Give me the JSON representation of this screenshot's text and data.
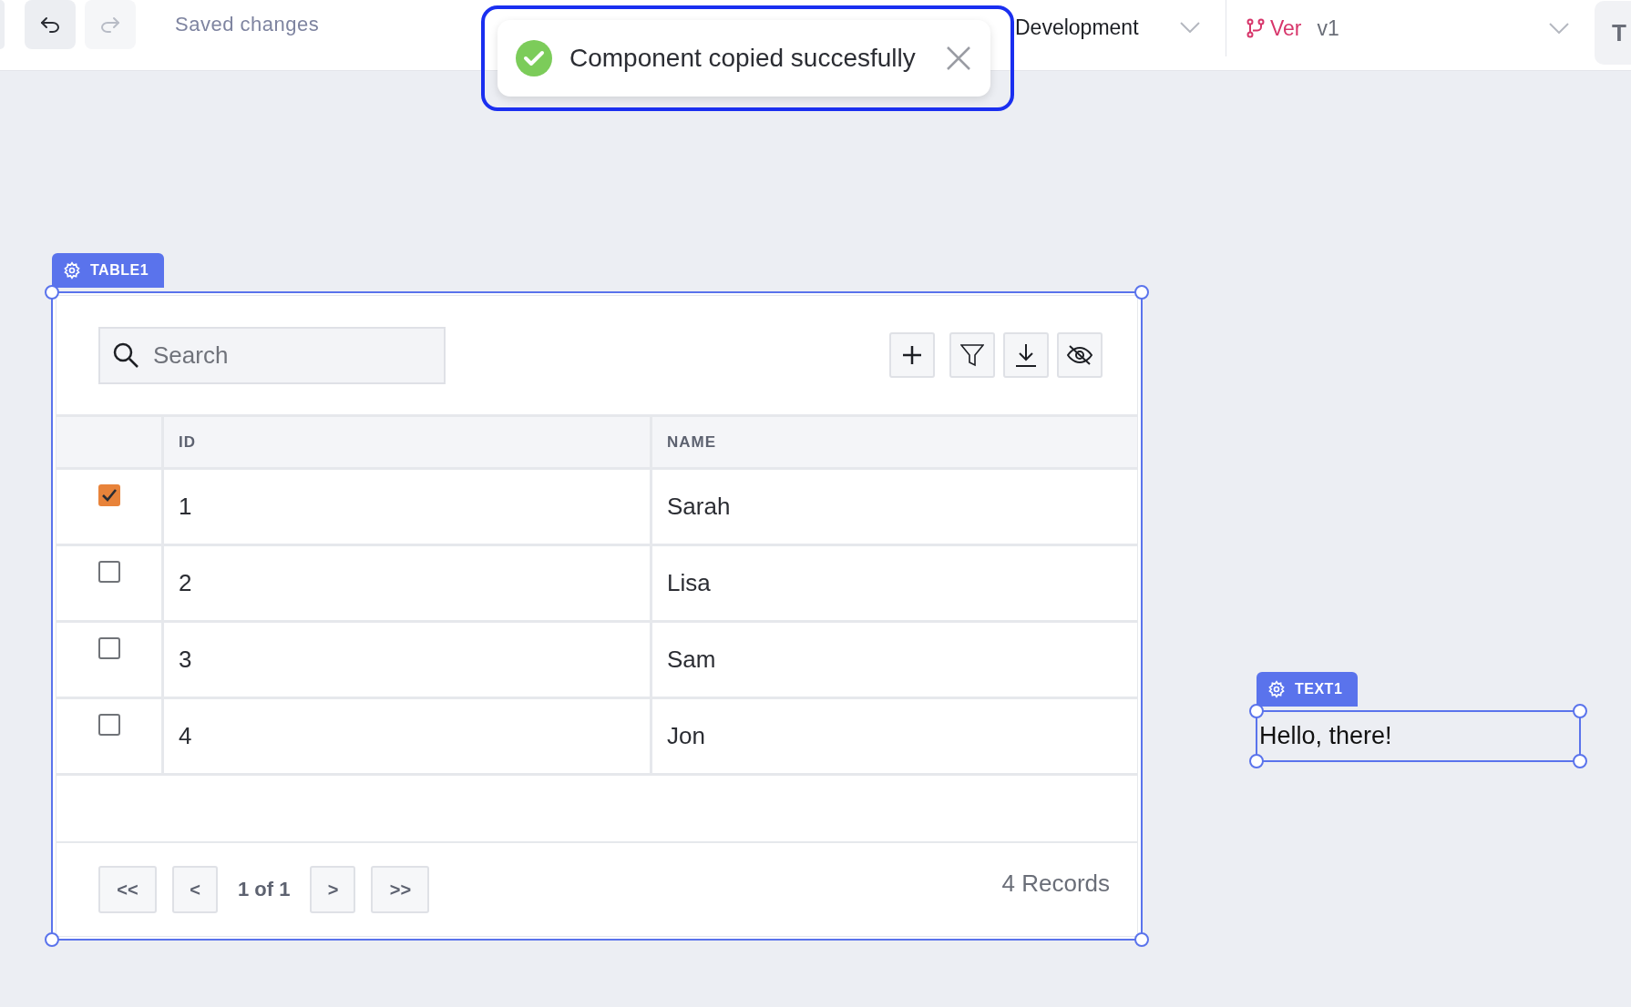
{
  "toolbar": {
    "undo": {
      "disabled": false
    },
    "redo": {
      "disabled": true
    },
    "status": "Saved changes",
    "environment": "Development",
    "version_label": "Ver",
    "version": "v1",
    "right_button": "T"
  },
  "toast": {
    "message": "Component copied succesfully",
    "focused": true
  },
  "table_widget": {
    "label": "TABLE1",
    "search": {
      "placeholder": "Search"
    },
    "columns": [
      "ID",
      "NAME"
    ],
    "rows": [
      {
        "id": "1",
        "name": "Sarah",
        "checked": true
      },
      {
        "id": "2",
        "name": "Lisa",
        "checked": false
      },
      {
        "id": "3",
        "name": "Sam",
        "checked": false
      },
      {
        "id": "4",
        "name": "Jon",
        "checked": false
      }
    ],
    "pagination": {
      "first": "<<",
      "prev": "<",
      "page": "1 of 1",
      "next": ">",
      "last": ">>"
    },
    "record_count": "4 Records"
  },
  "text_widget": {
    "label": "TEXT1",
    "text": "Hello, there!"
  }
}
